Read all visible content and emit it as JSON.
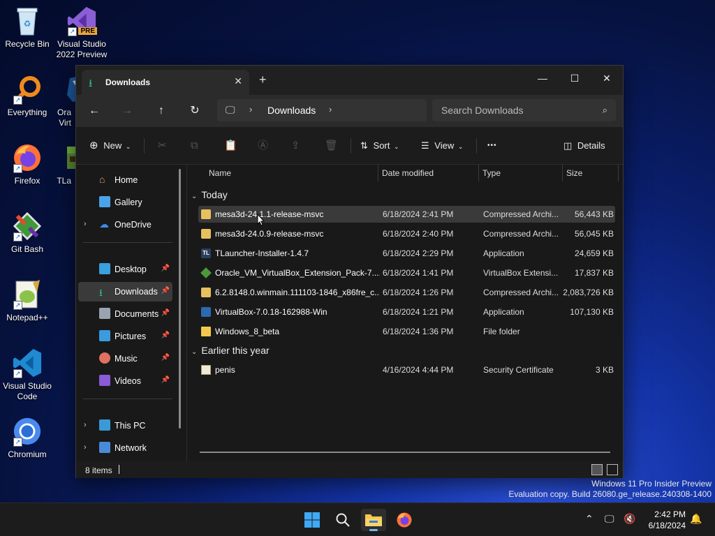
{
  "desktop": {
    "icons": [
      {
        "label": "Recycle Bin"
      },
      {
        "label": "Visual Studio 2022 Preview",
        "badge": "PRE"
      },
      {
        "label": "Everything"
      },
      {
        "label": "Ora Virt"
      },
      {
        "label": "Firefox"
      },
      {
        "label": "TLa"
      },
      {
        "label": "Git Bash"
      },
      {
        "label": "Notepad++"
      },
      {
        "label": "Visual Studio Code"
      },
      {
        "label": "Chromium"
      }
    ]
  },
  "window": {
    "tab_title": "Downloads",
    "new_tab": "+",
    "address": {
      "crumb": "Downloads"
    },
    "search": {
      "placeholder": "Search Downloads"
    },
    "toolbar": {
      "new_label": "New",
      "sort_label": "Sort",
      "view_label": "View",
      "more": "•••",
      "details_label": "Details"
    },
    "nav": {
      "items": [
        {
          "label": "Home"
        },
        {
          "label": "Gallery"
        },
        {
          "label": "OneDrive"
        },
        {
          "label": "Desktop"
        },
        {
          "label": "Downloads"
        },
        {
          "label": "Documents"
        },
        {
          "label": "Pictures"
        },
        {
          "label": "Music"
        },
        {
          "label": "Videos"
        },
        {
          "label": "This PC"
        },
        {
          "label": "Network"
        }
      ]
    },
    "columns": {
      "name": "Name",
      "date": "Date modified",
      "type": "Type",
      "size": "Size"
    },
    "groups": {
      "today": "Today",
      "earlier": "Earlier this year"
    },
    "files": [
      {
        "name": "mesa3d-24.1.1-release-msvc",
        "date": "6/18/2024 2:41 PM",
        "type": "Compressed Archi...",
        "size": "56,443 KB",
        "icon": "archive-icon"
      },
      {
        "name": "mesa3d-24.0.9-release-msvc",
        "date": "6/18/2024 2:40 PM",
        "type": "Compressed Archi...",
        "size": "56,045 KB",
        "icon": "archive-icon"
      },
      {
        "name": "TLauncher-Installer-1.4.7",
        "date": "6/18/2024 2:29 PM",
        "type": "Application",
        "size": "24,659 KB",
        "icon": "tlauncher-icon"
      },
      {
        "name": "Oracle_VM_VirtualBox_Extension_Pack-7....",
        "date": "6/18/2024 1:41 PM",
        "type": "VirtualBox Extensi...",
        "size": "17,837 KB",
        "icon": "vbox-ext-icon"
      },
      {
        "name": "6.2.8148.0.winmain.111103-1846_x86fre_c...",
        "date": "6/18/2024 1:26 PM",
        "type": "Compressed Archi...",
        "size": "2,083,726 KB",
        "icon": "archive-icon"
      },
      {
        "name": "VirtualBox-7.0.18-162988-Win",
        "date": "6/18/2024 1:21 PM",
        "type": "Application",
        "size": "107,130 KB",
        "icon": "virtualbox-icon"
      },
      {
        "name": "Windows_8_beta",
        "date": "6/18/2024 1:36 PM",
        "type": "File folder",
        "size": "",
        "icon": "folder-icon"
      },
      {
        "name": "penis",
        "date": "4/16/2024 4:44 PM",
        "type": "Security Certificate",
        "size": "3 KB",
        "icon": "certificate-icon"
      }
    ],
    "status": {
      "count": "8 items"
    }
  },
  "watermark": {
    "line1": "Windows 11 Pro Insider Preview",
    "line2": "Evaluation copy. Build 26080.ge_release.240308-1400"
  },
  "taskbar": {
    "time": "2:42 PM",
    "date": "6/18/2024"
  },
  "colors": {
    "accent": "#76b9ed",
    "selected_row": "#3a3a3a",
    "window_bg": "#191919"
  }
}
